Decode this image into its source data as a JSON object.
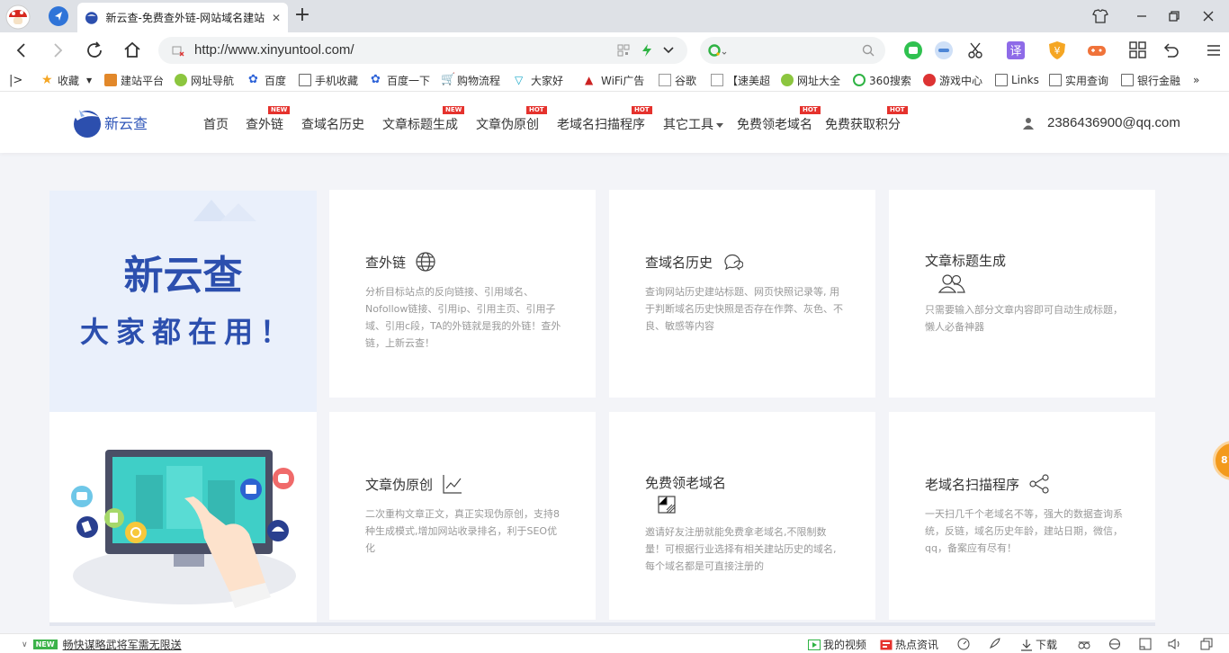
{
  "browser": {
    "tab_title": "新云查-免费查外链-网站域名建站",
    "url": "http://www.xinyuntool.com/",
    "search_placeholder": "",
    "bookmarks": [
      {
        "label": "收藏",
        "icon": "star-icon"
      },
      {
        "label": "建站平台",
        "icon": "bookmark-icon"
      },
      {
        "label": "网址导航",
        "icon": "bookmark-icon"
      },
      {
        "label": "百度",
        "icon": "baidu-icon"
      },
      {
        "label": "手机收藏",
        "icon": "folder-icon"
      },
      {
        "label": "百度一下",
        "icon": "baidu-icon"
      },
      {
        "label": "购物流程",
        "icon": "cart-icon"
      },
      {
        "label": "大家好",
        "icon": "bookmark-icon"
      },
      {
        "label": "WiFi广告",
        "icon": "bookmark-icon"
      },
      {
        "label": "谷歌",
        "icon": "page-icon"
      },
      {
        "label": "【速美超",
        "icon": "page-icon"
      },
      {
        "label": "网址大全",
        "icon": "bookmark-icon"
      },
      {
        "label": "360搜索",
        "icon": "bookmark-icon"
      },
      {
        "label": "游戏中心",
        "icon": "bookmark-icon"
      },
      {
        "label": "Links",
        "icon": "folder-icon"
      },
      {
        "label": "实用查询",
        "icon": "folder-icon"
      },
      {
        "label": "银行金融",
        "icon": "folder-icon"
      }
    ],
    "more": "»"
  },
  "site": {
    "logo": "新云查",
    "nav": [
      {
        "label": "首页",
        "badge": ""
      },
      {
        "label": "查外链",
        "badge": "NEW"
      },
      {
        "label": "查域名历史",
        "badge": ""
      },
      {
        "label": "文章标题生成",
        "badge": "NEW"
      },
      {
        "label": "文章伪原创",
        "badge": "HOT"
      },
      {
        "label": "老域名扫描程序",
        "badge": "HOT"
      },
      {
        "label": "其它工具",
        "badge": ""
      },
      {
        "label": "免费领老域名",
        "badge": "HOT"
      },
      {
        "label": "免费获取积分",
        "badge": "HOT"
      }
    ],
    "user": "2386436900@qq.com"
  },
  "banner": {
    "title": "新云查",
    "subtitle": "大家都在用！"
  },
  "cards": [
    {
      "title": "查外链",
      "icon": "globe-icon",
      "desc": "分析目标站点的反向链接、引用域名、Nofollow链接、引用ip、引用主页、引用子域、引用c段，TA的外链就是我的外链！查外链，上新云查！"
    },
    {
      "title": "查域名历史",
      "icon": "chat-icon",
      "desc": "查询网站历史建站标题、网页快照记录等, 用于判断域名历史快照是否存在作弊、灰色、不良、敏感等内容"
    },
    {
      "title": "文章标题生成",
      "icon": "users-icon",
      "desc": "只需要输入部分文章内容即可自动生成标题，懒人必备神器"
    },
    {
      "title": "文章伪原创",
      "icon": "trend-icon",
      "desc": "二次重构文章正文，真正实现伪原创，支持8种生成模式,增加网站收录排名，利于SEO优化"
    },
    {
      "title": "免费领老域名",
      "icon": "grid-icon",
      "desc": "邀请好友注册就能免费拿老域名,不限制数量！可根据行业选择有相关建站历史的域名,每个域名都是可直接注册的"
    },
    {
      "title": "老域名扫描程序",
      "icon": "share-icon",
      "desc": "一天扫几千个老域名不等，强大的数据查询系统，反链，域名历史年龄，建站日期，微信，qq，备案应有尽有！"
    }
  ],
  "float_ball": "81",
  "status": {
    "new_tag": "NEW",
    "news": "畅快谋略武将军需无限送",
    "my_video": "我的视频",
    "hot_news": "热点资讯",
    "download": "下载"
  }
}
